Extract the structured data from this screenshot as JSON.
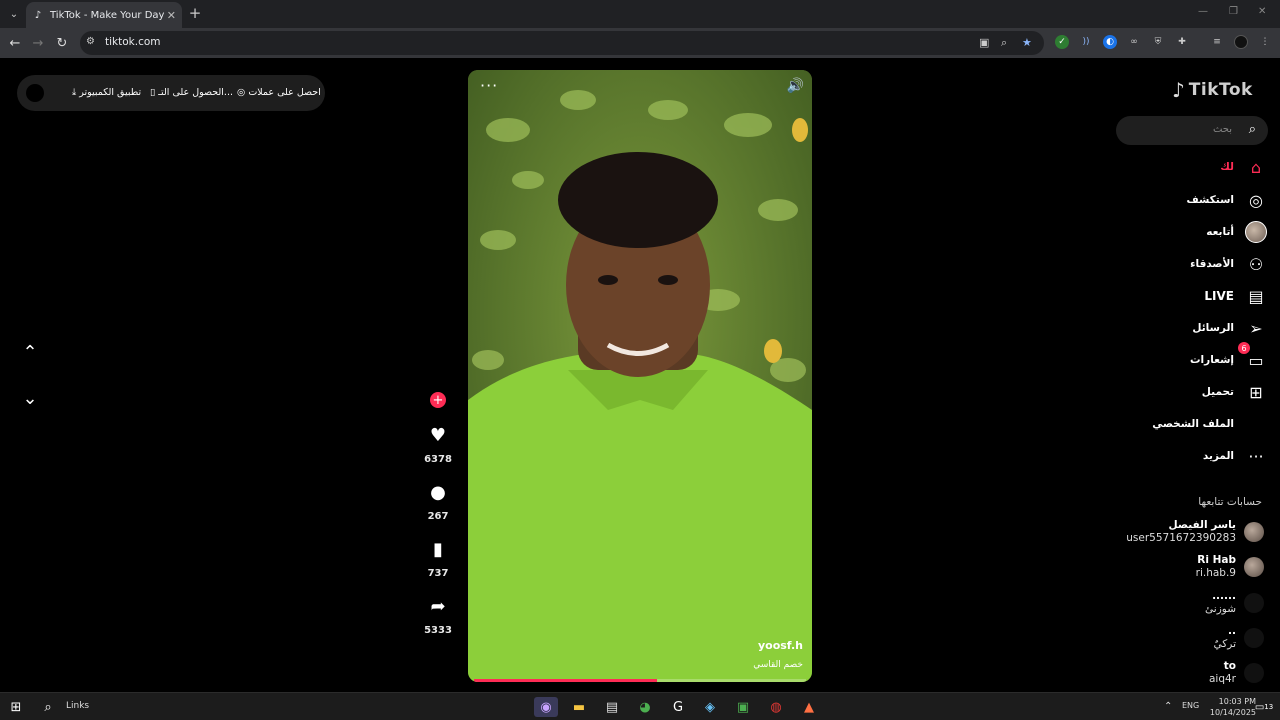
{
  "browser": {
    "tab_title": "TikTok - Make Your Day",
    "url": "tiktok.com"
  },
  "promo": {
    "desktop_app": "تطبيق الكمبيوتر",
    "get_app": "الحصول على التـ...",
    "get_coins": "احصل على عملات"
  },
  "logo": "TikTok",
  "search": {
    "placeholder": "بحث"
  },
  "nav": [
    {
      "label": "لك",
      "icon": "home-icon",
      "active": true
    },
    {
      "label": "استكشف",
      "icon": "compass-icon"
    },
    {
      "label": "أتابعه",
      "icon": "avatar-icon"
    },
    {
      "label": "الأصدقاء",
      "icon": "friends-icon"
    },
    {
      "label": "LIVE",
      "icon": "live-icon"
    },
    {
      "label": "الرسائل",
      "icon": "messages-icon"
    },
    {
      "label": "إشعارات",
      "icon": "notifications-icon",
      "badge": "6"
    },
    {
      "label": "تحميل",
      "icon": "upload-icon"
    },
    {
      "label": "الملف الشخصي",
      "icon": "profile-icon"
    },
    {
      "label": "المزيد",
      "icon": "more-icon"
    }
  ],
  "following_title": "حسابات تتابعها",
  "accounts": [
    {
      "name": "ياسر الفيصل",
      "handle": "user5571672390283"
    },
    {
      "name": "Ri Hab",
      "handle": "ri.hab.9"
    },
    {
      "name": "......",
      "handle": "شوزنئ"
    },
    {
      "name": "..",
      "handle": "تركيٌ"
    },
    {
      "name": "to",
      "handle": "aiq4r"
    }
  ],
  "video": {
    "author": "yoosf.h",
    "caption": "خصم القاسي",
    "progress": 0.55
  },
  "actions": {
    "likes": "6378",
    "comments": "267",
    "saves": "737",
    "shares": "5333"
  },
  "taskbar": {
    "links_label": "Links",
    "lang": "ENG",
    "time": "10:03 PM",
    "date": "10/14/2025",
    "notif_count": "13"
  }
}
